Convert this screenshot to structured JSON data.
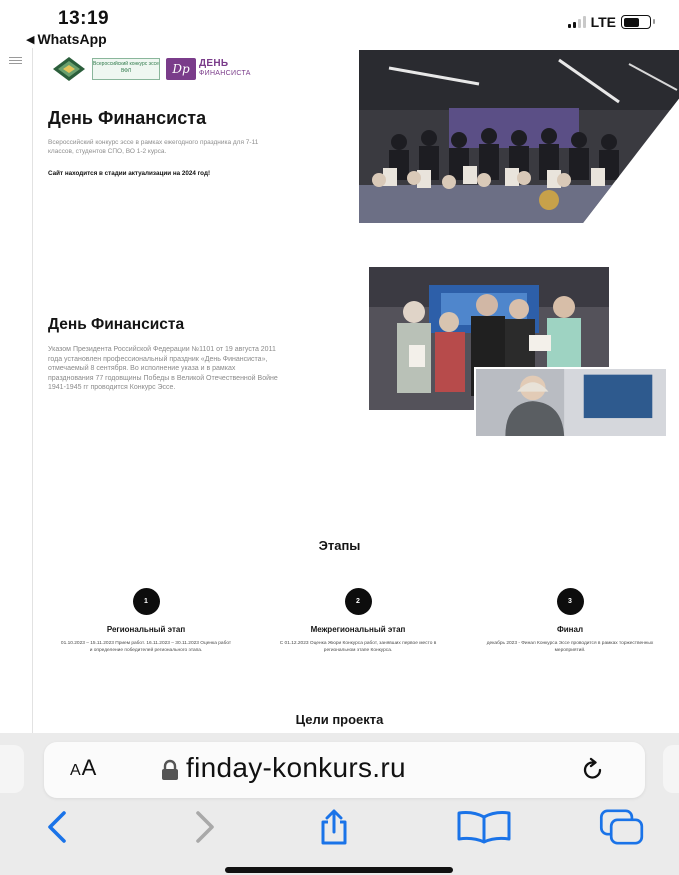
{
  "status": {
    "time": "13:19",
    "back_app": "WhatsApp",
    "network": "LTE",
    "battery_level": 0.6
  },
  "hero": {
    "title": "День Финансиста",
    "lead": "Всероссийский конкурс эссе в рамках ежегодного праздника для 7-11 классов, студентов СПО, ВО 1-2 курса.",
    "notice": "Сайт находится в стадии актуализации на 2024 год!"
  },
  "logos": {
    "green_logo_text": "Всероссийский конкурс эссе ВФЛ",
    "dayfin_line1": "ДЕНЬ",
    "dayfin_line2": "ФИНАНСИСТА"
  },
  "about": {
    "title": "День Финансиста",
    "text": "Указом Президента Российской Федерации №1101 от 19 августа 2011 года установлен профессиональный праздник «День Финансиста», отмечаемый 8 сентября. Во исполнение указа и в рамках празднования 77 годовщины Победы в Великой Отечественной Войне 1941-1945 гг проводится Конкурс Эссе."
  },
  "stages": {
    "title": "Этапы",
    "items": [
      {
        "num": "1",
        "title": "Региональный этап",
        "desc": "01.10.2023 – 15.11.2023 Прием работ. 16.11.2023 – 30.11.2023 Оценка работ и определение победителей регионального этапа."
      },
      {
        "num": "2",
        "title": "Межрегиональный этап",
        "desc": "С 01.12.2023 Оценка Жюри Конкурса работ, занявших первое место в региональном этапе Конкурса."
      },
      {
        "num": "3",
        "title": "Финал",
        "desc": "декабрь 2023 - Финал Конкурса Эссе проводится в рамках торжественных мероприятий."
      }
    ]
  },
  "goals": {
    "title": "Цели проекта"
  },
  "browser": {
    "aa_label_big": "A",
    "aa_label_small": "A",
    "url": "finday-konkurs.ru",
    "accent": "#1a73e8"
  },
  "icons": {
    "back": "chevron-left-icon",
    "forward": "chevron-right-icon",
    "share": "share-icon",
    "bookmarks": "book-icon",
    "tabs": "tabs-icon",
    "reload": "reload-icon",
    "lock": "lock-icon"
  }
}
